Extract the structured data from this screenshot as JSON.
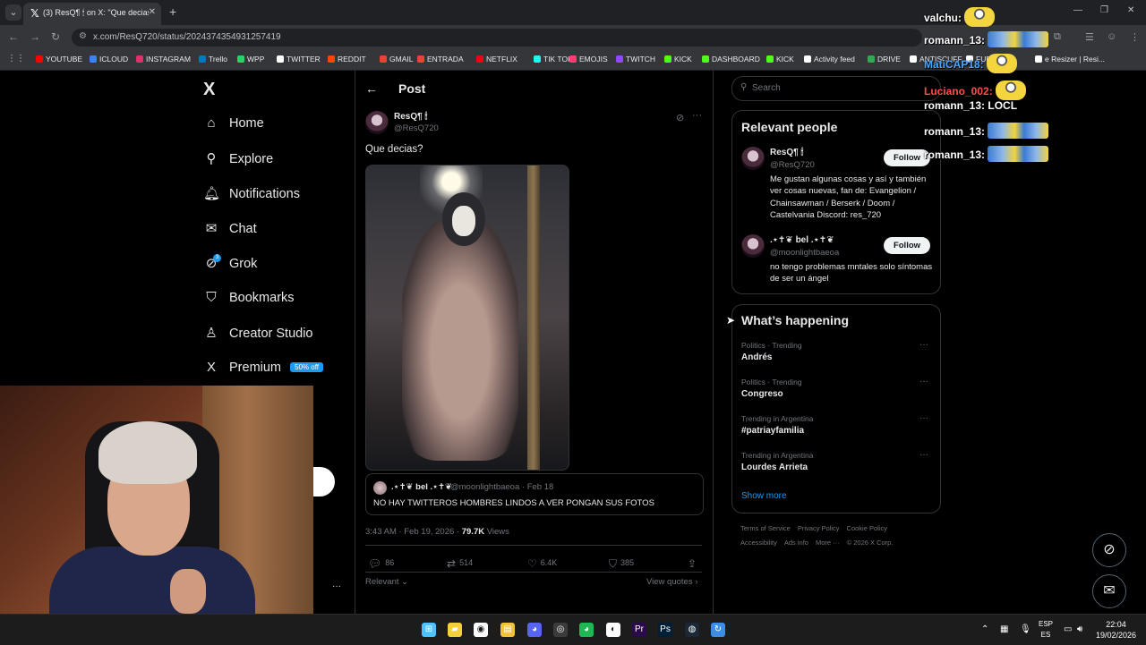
{
  "browser": {
    "tab_title": "(3) ResQ¶ 🕯 on X: \"Que decias?\"",
    "tab_favicon": "x-logo",
    "url": "x.com/ResQ720/status/2024374354931257419",
    "bookmarks": [
      {
        "label": "YOUTUBE",
        "color": "#ff0000"
      },
      {
        "label": "ICLOUD",
        "color": "#3b82f6"
      },
      {
        "label": "INSTAGRAM",
        "color": "#e1306c"
      },
      {
        "label": "Trello",
        "color": "#0079bf"
      },
      {
        "label": "WPP",
        "color": "#25d366"
      },
      {
        "label": "TWITTER",
        "color": "#ffffff"
      },
      {
        "label": "REDDIT",
        "color": "#ff4500"
      },
      {
        "label": "GMAIL",
        "color": "#ea4335"
      },
      {
        "label": "ENTRADA",
        "color": "#ea4335"
      },
      {
        "label": "NETFLIX",
        "color": "#e50914"
      },
      {
        "label": "TIK TOK",
        "color": "#25f4ee"
      },
      {
        "label": "EMOJIS",
        "color": "#ff3d6e"
      },
      {
        "label": "TWITCH",
        "color": "#9146ff"
      },
      {
        "label": "KICK",
        "color": "#53fc18"
      },
      {
        "label": "DASHBOARD",
        "color": "#53fc18"
      },
      {
        "label": "KICK",
        "color": "#53fc18"
      },
      {
        "label": "Activity feed",
        "color": "#ffffff"
      },
      {
        "label": "DRIVE",
        "color": "#34a853"
      },
      {
        "label": "ANTISCUFF",
        "color": "#ffffff"
      },
      {
        "label": "FUENTE",
        "color": "#ffffff"
      },
      {
        "label": "e Resizer | Resi...",
        "color": "#ffffff"
      }
    ]
  },
  "sidebar": {
    "logo": "X",
    "items": [
      {
        "label": "Home",
        "icon": "home-icon",
        "glyph": "⌂"
      },
      {
        "label": "Explore",
        "icon": "search-icon",
        "glyph": "⚲"
      },
      {
        "label": "Notifications",
        "icon": "bell-icon",
        "glyph": "🔔︎"
      },
      {
        "label": "Chat",
        "icon": "mail-icon",
        "glyph": "✉"
      },
      {
        "label": "Grok",
        "icon": "grok-icon",
        "glyph": "⊘"
      },
      {
        "label": "Bookmarks",
        "icon": "bookmark-icon",
        "glyph": "⛉"
      },
      {
        "label": "Creator Studio",
        "icon": "flask-icon",
        "glyph": "♙"
      },
      {
        "label": "Premium",
        "icon": "x-icon",
        "glyph": "X"
      }
    ],
    "notification_count": "3",
    "premium_badge": "50% off"
  },
  "post": {
    "header": "Post",
    "author_name": "ResQ¶ 🕯",
    "author_handle": "@ResQ720",
    "text": "Que decias?",
    "quote": {
      "name": ".⋆✝︎❦ bel .⋆✝︎❦",
      "handle": "@moonlightbaeoa",
      "date": "Feb 18",
      "text": "NO HAY TWITTEROS HOMBRES LINDOS A VER PONGAN SUS FOTOS"
    },
    "timestamp": "3:43 AM · Feb 19, 2026 · ",
    "views_count": "79.7K",
    "views_label": " Views",
    "actions": {
      "replies": "86",
      "reposts": "514",
      "likes": "6.4K",
      "bookmarks": "385"
    },
    "sort_label": "Relevant",
    "view_quotes": "View quotes"
  },
  "right": {
    "search_placeholder": "Search",
    "relevant_title": "Relevant people",
    "people": [
      {
        "name": "ResQ¶ 🕯",
        "handle": "@ResQ720",
        "bio": "Me gustan algunas cosas y así y también ver cosas nuevas, fan de: Evangelion / Chainsawman / Berserk / Doom / Castelvania Discord: res_720",
        "button": "Follow"
      },
      {
        "name": ".⋆✝︎❦ bel .⋆✝︎❦",
        "handle": "@moonlightbaeoa",
        "bio": "no tengo problemas mntales solo síntomas de ser un ángel",
        "button": "Follow"
      }
    ],
    "happening_title": "What’s happening",
    "trends": [
      {
        "category": "Politics · Trending",
        "name": "Andrés"
      },
      {
        "category": "Politics · Trending",
        "name": "Congreso"
      },
      {
        "category": "Trending in Argentina",
        "name": "#patriayfamilia"
      },
      {
        "category": "Trending in Argentina",
        "name": "Lourdes Arrieta"
      }
    ],
    "show_more": "Show more",
    "footer": [
      "Terms of Service",
      "Privacy Policy",
      "Cookie Policy",
      "Accessibility",
      "Ads info",
      "More ···",
      "© 2026 X Corp."
    ]
  },
  "chat": [
    {
      "user": "valchu:",
      "message": "",
      "emote": "minion",
      "color": "#ffffff"
    },
    {
      "user": "romann_13:",
      "message": "",
      "emote": "team",
      "color": "#ffffff"
    },
    {
      "user": "MatiCAP18:",
      "message": "",
      "emote": "minion",
      "color": "#4aa8ff"
    },
    {
      "user": "Luciano_002:",
      "message": "",
      "emote": "minion",
      "color": "#ff4d4d"
    },
    {
      "user": "romann_13:",
      "message": "LOCL",
      "emote": "",
      "color": "#ffffff"
    },
    {
      "user": "romann_13:",
      "message": "",
      "emote": "team",
      "color": "#ffffff"
    },
    {
      "user": "romann_13:",
      "message": "",
      "emote": "team",
      "color": "#ffffff"
    }
  ],
  "webcam": {
    "watermark": "FR"
  },
  "taskbar": {
    "apps": [
      "windows-icon",
      "sticky-notes-icon",
      "chrome-icon",
      "file-explorer-icon",
      "discord-icon",
      "obs-icon",
      "spotify-icon",
      "github-icon",
      "premiere-icon",
      "photoshop-icon",
      "steam-icon",
      "app-icon"
    ],
    "lang_top": "ESP",
    "lang_bottom": "ES",
    "time": "22:04",
    "date": "19/02/2026"
  }
}
